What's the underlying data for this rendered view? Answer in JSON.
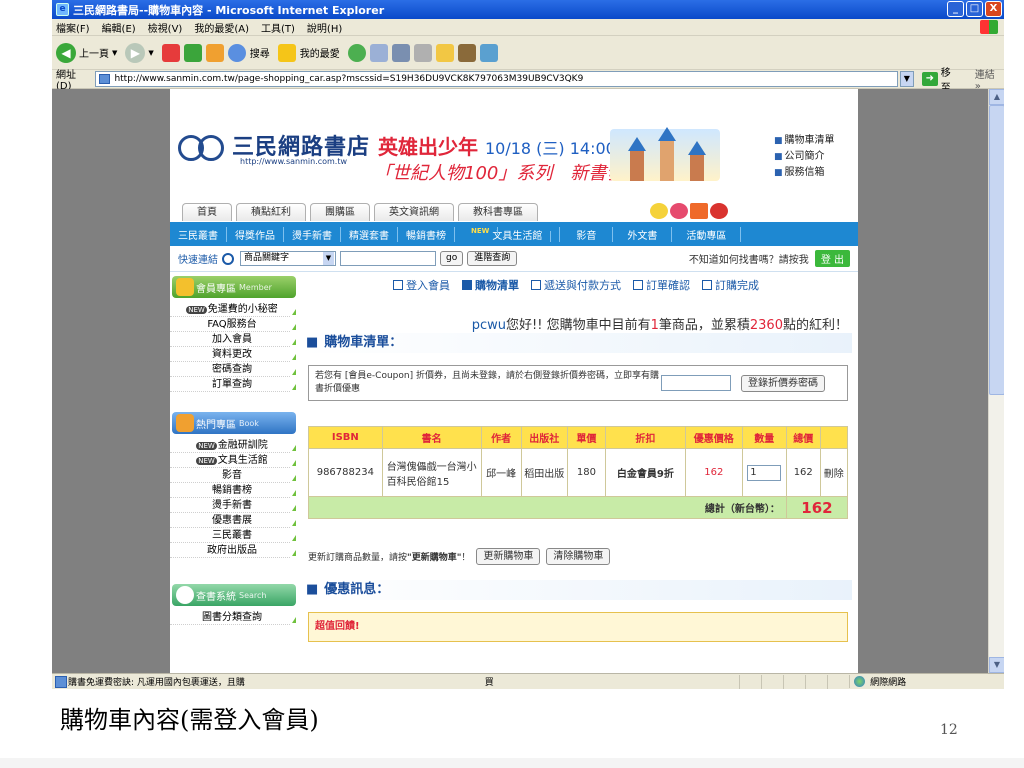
{
  "window": {
    "title": "三民網路書局--購物車內容 - Microsoft Internet Explorer",
    "controls": [
      "_",
      "□",
      "X"
    ]
  },
  "menu": [
    "檔案(F)",
    "編輯(E)",
    "檢視(V)",
    "我的最愛(A)",
    "工具(T)",
    "說明(H)"
  ],
  "toolbar": {
    "back_label": "上一頁",
    "search_label": "搜尋",
    "favorites_label": "我的最愛"
  },
  "address": {
    "label": "網址(D)",
    "url": "http://www.sanmin.com.tw/page-shopping_car.asp?mscssid=S19H36DU9VCK8K797063M39UB9CV3QK9",
    "go_label": "移至",
    "links_label": "連結 »"
  },
  "site": {
    "logo_title": "三民網路書店",
    "logo_url": "http://www.sanmin.com.tw",
    "promo_line1": "英雄出少年",
    "promo_date": "10/18 (三) 14:00~15:30",
    "promo_line2": "「世紀人物100」系列　新書發表會",
    "side_links": [
      "購物車清單",
      "公司簡介",
      "服務信箱"
    ],
    "tabs": [
      "首頁",
      "積點紅利",
      "團購區",
      "英文資訊網",
      "教科書專區"
    ],
    "nav": [
      "三民叢書",
      "得獎作品",
      "燙手新書",
      "精選套書",
      "暢銷書榜",
      "文具生活館",
      "影音",
      "外文書",
      "活動專區"
    ],
    "nav_new_tag": "NEW",
    "search": {
      "label": "快速連結",
      "select_value": "商品關鍵字",
      "go_label": "go",
      "advanced_label": "進階查詢",
      "help_text": "不知道如何找書嗎？請按我",
      "exit_label": "登 出"
    }
  },
  "leftnav": {
    "member_header": "會員專區",
    "member_header_en": "Member",
    "member_items": [
      "免運費的小秘密",
      "FAQ服務台",
      "加入會員",
      "資料更改",
      "密碼查詢",
      "訂單查詢"
    ],
    "new_mark": "NEW",
    "book_header": "熱門專區",
    "book_header_en": "Book",
    "book_items": [
      "金融研訓院",
      "文具生活館",
      "影音",
      "暢銷書榜",
      "燙手新書",
      "優惠書展",
      "三民叢書",
      "政府出版品"
    ],
    "search_header": "查書系統",
    "search_header_en": "Search",
    "search_items": [
      "圖書分類查詢"
    ]
  },
  "steps": [
    "登入會員",
    "購物清單",
    "遞送與付款方式",
    "訂單確認",
    "訂購完成"
  ],
  "greeting": {
    "user": "pcwu",
    "part1": "您好!! 您購物車中目前有",
    "count": "1",
    "part2": "筆商品，並累積",
    "points": "2360",
    "part3": "點的紅利！"
  },
  "cart": {
    "title": "購物車清單：",
    "coupon_text": "若您有 [會員e-Coupon] 折價券，且尚未登錄，請於右側登錄折價券密碼，立即享有購書折價優惠",
    "coupon_button": "登錄折價券密碼",
    "columns": [
      "ISBN",
      "書名",
      "作者",
      "出版社",
      "單價",
      "折扣",
      "優惠價格",
      "數量",
      "總價",
      ""
    ],
    "rows": [
      {
        "isbn": "986788234",
        "title": "台灣傀儡戲一台灣小百科民俗館15",
        "author": "邱一峰",
        "publisher": "稻田出版",
        "price": "180",
        "discount": "白金會員9折",
        "sale_price": "162",
        "qty": "1",
        "total": "162",
        "delete": "刪除"
      }
    ],
    "total_label": "總計（新台幣）：",
    "total_value": "162",
    "update_text1": "更新訂購商品數量，請按",
    "update_text_bold": "\"更新購物車\"",
    "update_text2": "！",
    "update_button": "更新購物車",
    "clear_button": "清除購物車"
  },
  "promo": {
    "title": "優惠訊息：",
    "text": "超值回饋!"
  },
  "status": {
    "text": "購書免運費密訣: 凡運用國內包裹運送，且購",
    "mid": "買",
    "zone": "網際網路"
  },
  "slide": {
    "caption": "購物車內容(需登入會員)",
    "page_number": "12"
  }
}
